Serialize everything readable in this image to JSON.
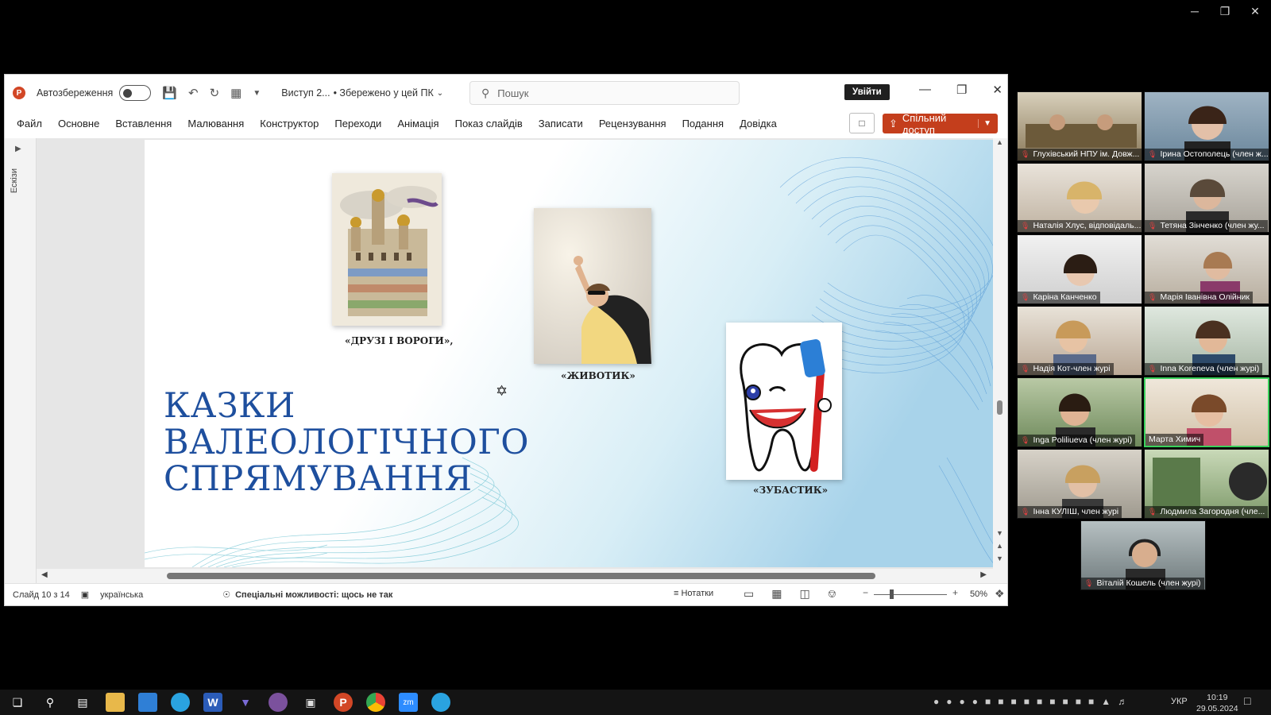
{
  "share_controls": {
    "minimize": "─",
    "restore": "❐",
    "close": "✕"
  },
  "titlebar": {
    "autosave_label": "Автозбереження",
    "doc_name": "Виступ 2...",
    "doc_status": "• Збережено у цей ПК",
    "search_placeholder": "Пошук",
    "login": "Увійти"
  },
  "menu": [
    "Файл",
    "Основне",
    "Вставлення",
    "Малювання",
    "Конструктор",
    "Переходи",
    "Анімація",
    "Показ слайдів",
    "Записати",
    "Рецензування",
    "Подання",
    "Довідка"
  ],
  "share_button": "Спільний доступ",
  "thumbnails_label": "Ескізи",
  "slide": {
    "title_lines": [
      "КАЗКИ",
      "ВАЛЕОЛОГІЧНОГО",
      "СПРЯМУВАННЯ"
    ],
    "captions": [
      "«ДРУЗІ І ВОРОГИ»,",
      "«ЖИВОТИК»",
      "«ЗУБАСТИК»"
    ]
  },
  "status": {
    "slide_counter": "Слайд 10 з 14",
    "language": "українська",
    "accessibility": "Спеціальні можливості: щось не так",
    "notes": "Нотатки",
    "zoom": "50%",
    "zoom_percent": 50
  },
  "participants": [
    "Глухівський НПУ ім. Довж...",
    "Ірина Остополець (член ж...",
    "Наталія Хлус, відповідаль...",
    "Тетяна Зінченко (член жу...",
    "Каріна Канченко",
    "Марія Іванівна Олійник",
    "Надія Кот-член журі",
    "Inna Koreneva (член журі)",
    "Inga Poliliueva (член журі)",
    "Марта Химич",
    "Інна КУЛІШ, член журі",
    "Людмила Загородня (чле...",
    "Віталій Кошель (член журі)"
  ],
  "taskbar": {
    "lang": "УКР",
    "time": "10:19",
    "date": "29.05.2024"
  }
}
